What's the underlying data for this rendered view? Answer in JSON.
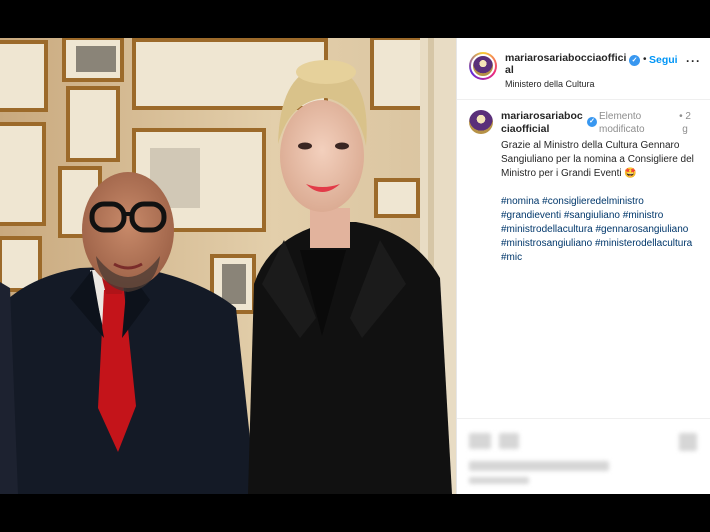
{
  "post": {
    "username": "mariarosariabocciaofficial",
    "location": "Ministero della Cultura",
    "follow_label": "Segui",
    "verified_glyph": "✓",
    "separator": "•",
    "more_label": "···"
  },
  "caption": {
    "username": "mariarosariabocciaofficial",
    "edited_label": "Elemento modificato",
    "time": "• 2 g",
    "text": "Grazie al Ministro della Cultura Gennaro Sangiuliano per la nomina a Consigliere del Ministro per i Grandi Eventi 🤩",
    "hashtags": [
      "#nomina",
      "#consiglieredelministro",
      "#grandieventi",
      "#sangiuliano",
      "#ministro",
      "#ministrodellacultura",
      "#gennarosangiuliano",
      "#ministrosangiuliano",
      "#ministerodellacultura",
      "#mic"
    ]
  },
  "icons": {
    "avatar": "profile-avatar-icon",
    "verified": "verified-badge-icon",
    "more": "more-options-icon"
  },
  "colors": {
    "follow": "#0095f6",
    "verified": "#3897f0",
    "hashtag": "#00376b",
    "muted": "#8e8e8e"
  }
}
